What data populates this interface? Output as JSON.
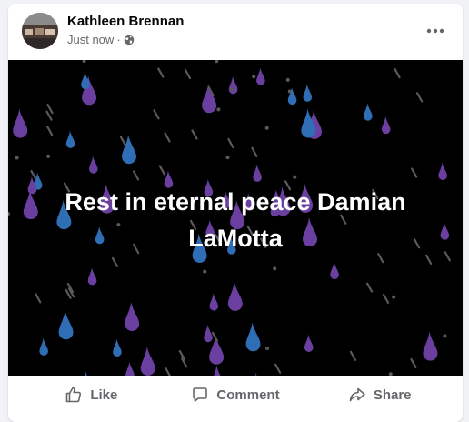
{
  "post": {
    "author": "Kathleen Brennan",
    "timestamp": "Just now",
    "separator": "·",
    "privacy_icon": "globe-icon",
    "menu_icon": "more-horizontal-icon",
    "image_text": "Rest in eternal peace Damian LaMotta",
    "image_background": "#000000",
    "rain_colors": [
      "#6a3fa0",
      "#2f6db5",
      "#5a5a5a"
    ]
  },
  "actions": {
    "like_label": "Like",
    "comment_label": "Comment",
    "share_label": "Share"
  }
}
